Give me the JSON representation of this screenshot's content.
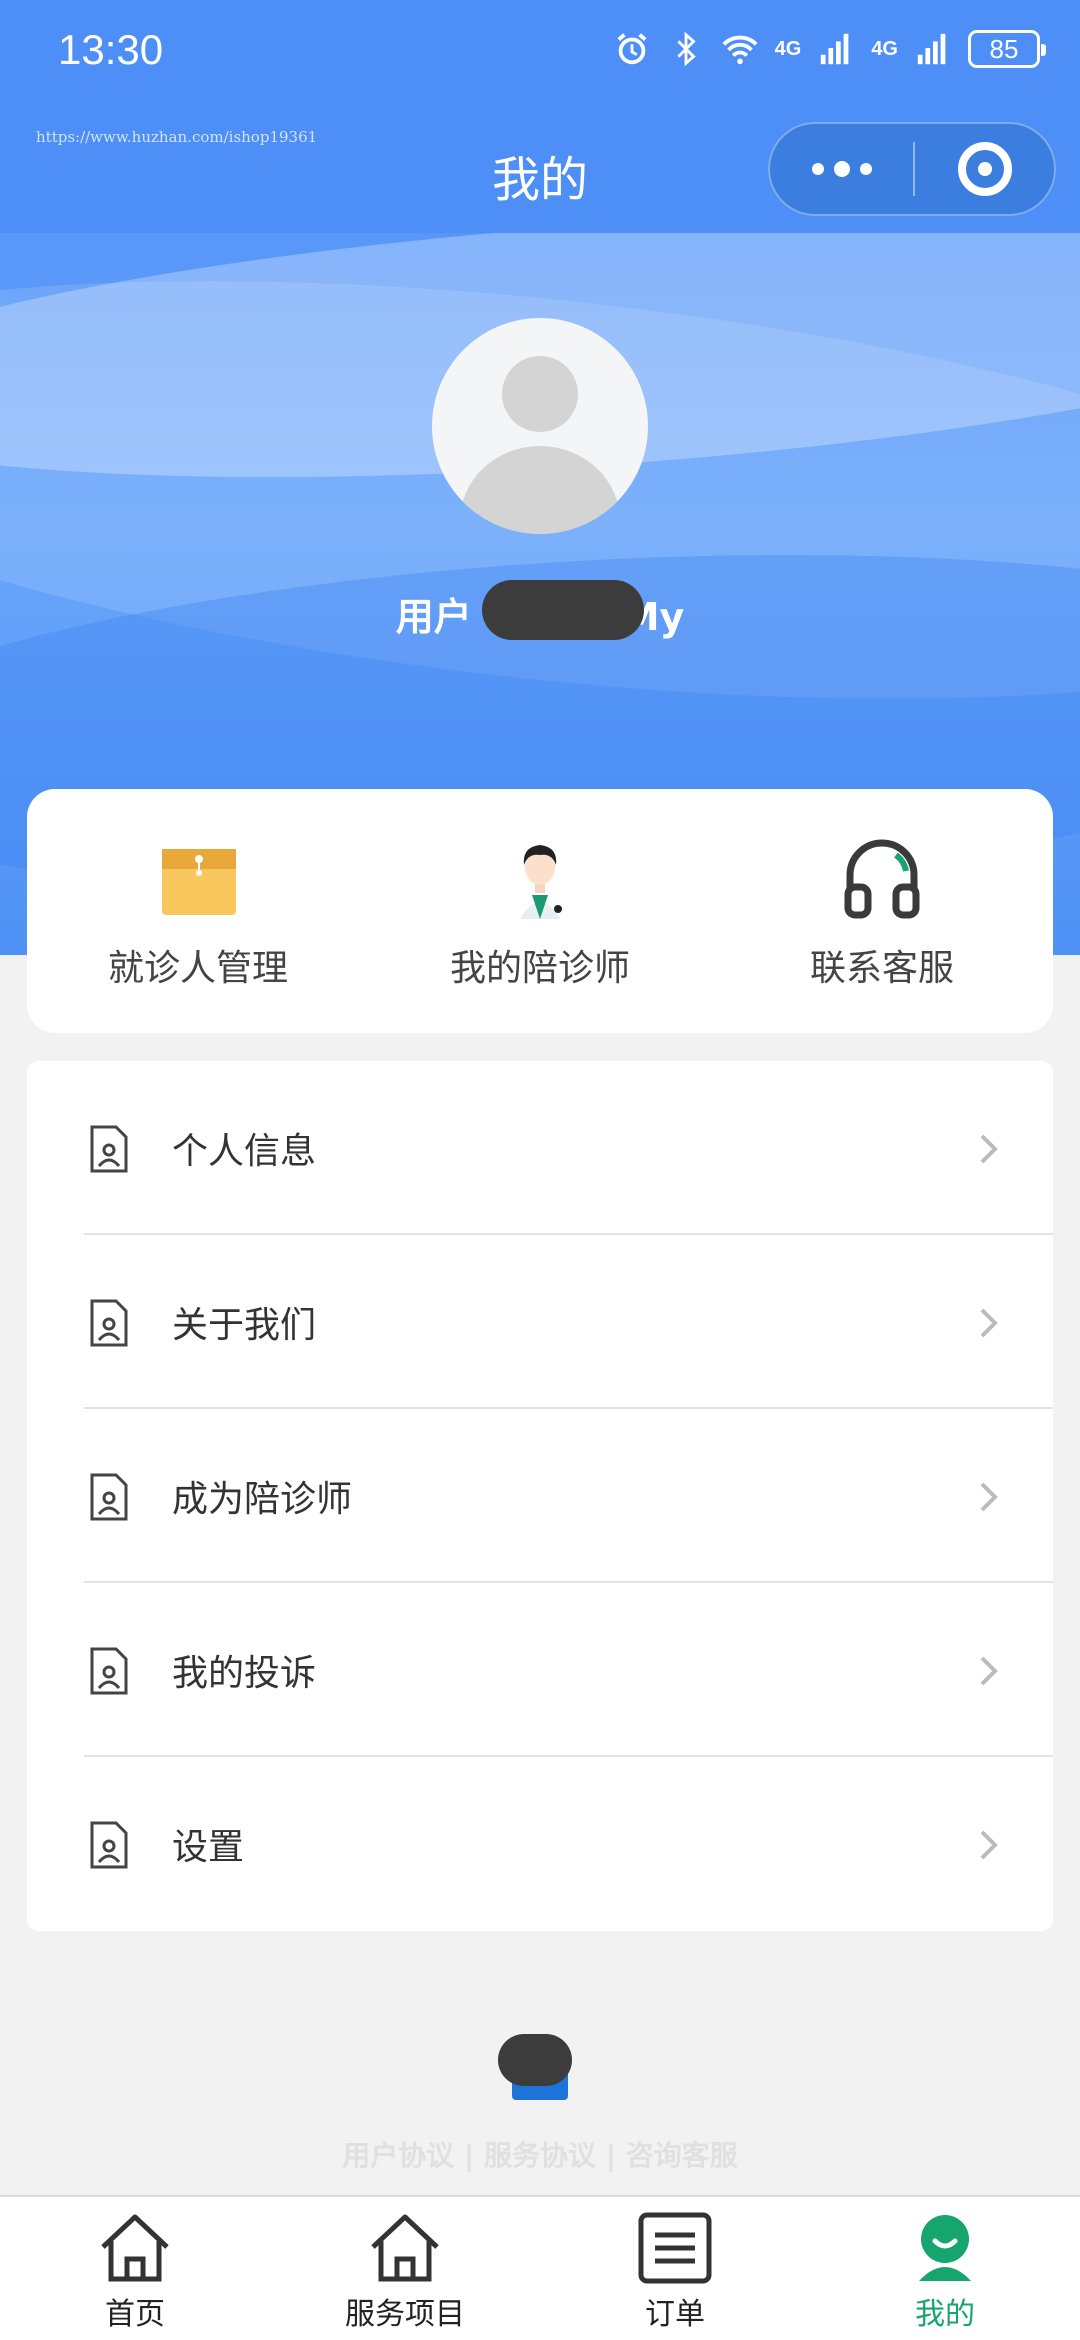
{
  "status_bar": {
    "time": "13:30",
    "network_1": "4G",
    "network_2": "4G",
    "battery": "85"
  },
  "watermark": "https://www.huzhan.com/ishop19361",
  "nav": {
    "title": "我的"
  },
  "profile": {
    "username_start": "用户",
    "username_end": "My"
  },
  "quick_actions": [
    {
      "label": "就诊人管理",
      "icon": "folder-icon"
    },
    {
      "label": "我的陪诊师",
      "icon": "doctor-icon"
    },
    {
      "label": "联系客服",
      "icon": "headset-icon"
    }
  ],
  "menu": [
    {
      "label": "个人信息",
      "icon": "profile-doc-icon"
    },
    {
      "label": "关于我们",
      "icon": "profile-doc-icon"
    },
    {
      "label": "成为陪诊师",
      "icon": "profile-doc-icon"
    },
    {
      "label": "我的投诉",
      "icon": "profile-doc-icon"
    },
    {
      "label": "设置",
      "icon": "profile-doc-icon"
    }
  ],
  "footer_links": [
    "用户协议",
    "服务协议",
    "咨询客服"
  ],
  "tabs": [
    {
      "label": "首页",
      "icon": "home-icon",
      "active": false
    },
    {
      "label": "服务项目",
      "icon": "home-icon",
      "active": false
    },
    {
      "label": "订单",
      "icon": "list-icon",
      "active": false
    },
    {
      "label": "我的",
      "icon": "user-icon",
      "active": true
    }
  ],
  "colors": {
    "brand_blue": "#4d8ff7",
    "active_green": "#16a56f"
  }
}
